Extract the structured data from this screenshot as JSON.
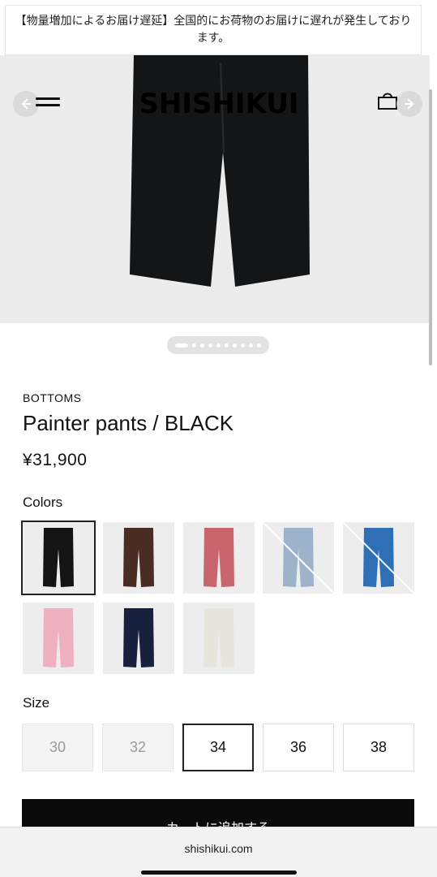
{
  "notice": {
    "text": "【物量増加によるお届け遅延】全国的にお荷物のお届けに遅れが発生しております。"
  },
  "header": {
    "logo": "SHISHIKUI"
  },
  "gallery": {
    "slide_count": 10,
    "active_slide": 1
  },
  "product": {
    "category": "BOTTOMS",
    "title": "Painter pants / BLACK",
    "price": "¥31,900"
  },
  "colors": {
    "label": "Colors",
    "swatches": [
      {
        "name": "black",
        "color": "#141414",
        "selected": true,
        "sold_out": false
      },
      {
        "name": "brown",
        "color": "#4a2d22",
        "selected": false,
        "sold_out": false
      },
      {
        "name": "rose",
        "color": "#c9666d",
        "selected": false,
        "sold_out": false
      },
      {
        "name": "light-blue",
        "color": "#9db3cb",
        "selected": false,
        "sold_out": true
      },
      {
        "name": "blue",
        "color": "#2e6fb5",
        "selected": false,
        "sold_out": true
      },
      {
        "name": "pink",
        "color": "#efb0c2",
        "selected": false,
        "sold_out": false
      },
      {
        "name": "navy",
        "color": "#17213d",
        "selected": false,
        "sold_out": false
      },
      {
        "name": "ivory",
        "color": "#e8e6dc",
        "selected": false,
        "sold_out": false
      }
    ]
  },
  "size": {
    "label": "Size",
    "options": [
      {
        "label": "30",
        "disabled": true,
        "selected": false
      },
      {
        "label": "32",
        "disabled": true,
        "selected": false
      },
      {
        "label": "34",
        "disabled": false,
        "selected": true
      },
      {
        "label": "36",
        "disabled": false,
        "selected": false
      },
      {
        "label": "38",
        "disabled": false,
        "selected": false
      }
    ]
  },
  "add_to_cart": {
    "label": "カートに追加する"
  },
  "browser": {
    "url": "shishikui.com"
  }
}
